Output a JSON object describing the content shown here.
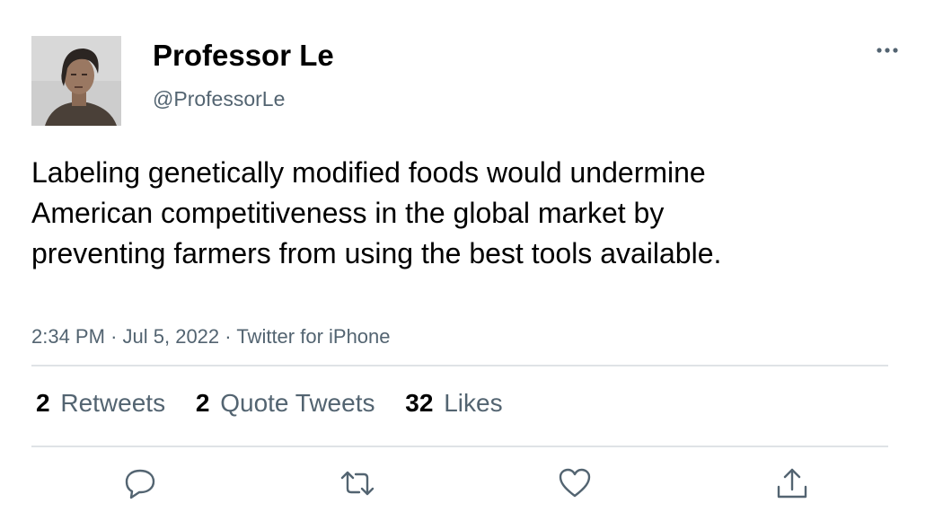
{
  "user": {
    "display_name": "Professor Le",
    "handle": "@ProfessorLe",
    "avatar_icon": "profile-photo"
  },
  "tweet": {
    "text": "Labeling genetically modified foods would undermine American competitiveness in the global market by preventing farmers from using the best tools available.",
    "time": "2:34 PM",
    "date": "Jul 5, 2022",
    "source": "Twitter for iPhone",
    "separator": "·"
  },
  "stats": {
    "retweets": {
      "count": "2",
      "label": "Retweets"
    },
    "quote_tweets": {
      "count": "2",
      "label": "Quote Tweets"
    },
    "likes": {
      "count": "32",
      "label": "Likes"
    }
  },
  "actions": {
    "reply": "reply-icon",
    "retweet": "retweet-icon",
    "like": "heart-icon",
    "share": "share-icon",
    "more": "more-icon"
  },
  "colors": {
    "secondary_text": "#536471",
    "divider": "#dfe3e6",
    "icon": "#536471"
  }
}
